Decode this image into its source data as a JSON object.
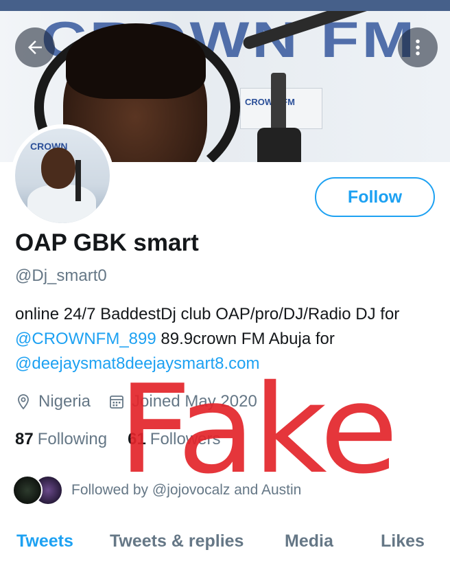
{
  "profile": {
    "name": "OAP GBK smart",
    "handle": "@Dj_smart0",
    "follow_label": "Follow",
    "bio": {
      "part1": "online 24/7 BaddestDj club OAP/pro/DJ/Radio DJ for ",
      "mention1": "@CROWNFM_899",
      "part2": " 89.9crown FM Abuja for ",
      "mention2": "@deejaysmat8deejaysmart8.com"
    },
    "location": "Nigeria",
    "joined": "Joined May 2020",
    "following_count": "87",
    "following_label": "Following",
    "followers_count": "61",
    "followers_label": "Followers",
    "followed_by": "Followed by @jojovocalz and Austin"
  },
  "banner": {
    "logo_text": "CROWN FM",
    "sign_text": "CROWN FM"
  },
  "avatar": {
    "logo_text": "CROWN"
  },
  "tabs": [
    {
      "label": "Tweets",
      "active": true
    },
    {
      "label": "Tweets & replies",
      "active": false
    },
    {
      "label": "Media",
      "active": false
    },
    {
      "label": "Likes",
      "active": false
    }
  ],
  "watermark": "Fake",
  "colors": {
    "accent": "#1da1f2",
    "secondary_text": "#657786",
    "watermark": "#e3252b",
    "status_strip": "#46608a"
  },
  "icons": {
    "back": "arrow-left-icon",
    "more": "more-vertical-icon",
    "location": "location-pin-icon",
    "calendar": "calendar-icon"
  }
}
